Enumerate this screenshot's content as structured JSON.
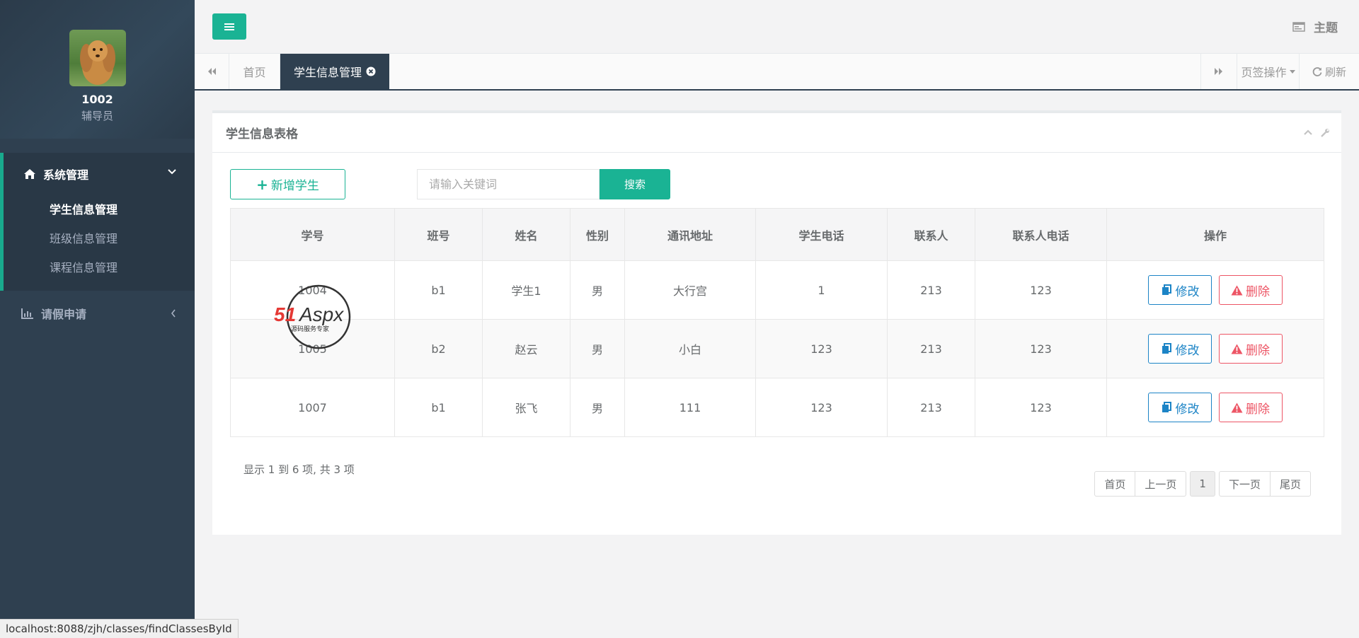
{
  "profile": {
    "name": "1002",
    "role": "辅导员"
  },
  "sidebar": {
    "group1": {
      "label": "系统管理",
      "icon": "home-icon",
      "items": [
        {
          "label": "学生信息管理",
          "active": true
        },
        {
          "label": "班级信息管理",
          "active": false
        },
        {
          "label": "课程信息管理",
          "active": false
        }
      ]
    },
    "group2": {
      "label": "请假申请",
      "icon": "bar-chart-icon"
    }
  },
  "topbar": {
    "theme_label": "主题"
  },
  "tabs": {
    "home_label": "首页",
    "active_label": "学生信息管理",
    "ops_label": "页签操作",
    "refresh_label": "刷新"
  },
  "panel": {
    "title": "学生信息表格",
    "add_label": "新增学生",
    "search_placeholder": "请输入关键词",
    "search_label": "搜索"
  },
  "table": {
    "headers": [
      "学号",
      "班号",
      "姓名",
      "性别",
      "通讯地址",
      "学生电话",
      "联系人",
      "联系人电话",
      "操作"
    ],
    "rows": [
      [
        "1004",
        "b1",
        "学生1",
        "男",
        "大行宫",
        "1",
        "213",
        "123"
      ],
      [
        "1005",
        "b2",
        "赵云",
        "男",
        "小白",
        "123",
        "213",
        "123"
      ],
      [
        "1007",
        "b1",
        "张飞",
        "男",
        "111",
        "123",
        "213",
        "123"
      ]
    ],
    "edit_label": "修改",
    "delete_label": "删除"
  },
  "footer": {
    "summary": "显示 1 到 6 项, 共 3 项",
    "pager": {
      "first": "首页",
      "prev": "上一页",
      "current": "1",
      "next": "下一页",
      "last": "尾页"
    }
  },
  "watermark": {
    "brand": "51Aspx",
    "tagline": "源码服务专家"
  },
  "statusbar": {
    "url": "localhost:8088/zjh/classes/findClassesById"
  },
  "colors": {
    "sidebar_bg": "#2f4050",
    "accent": "#1ab394",
    "edit": "#1c84c6",
    "delete": "#ed5565"
  }
}
